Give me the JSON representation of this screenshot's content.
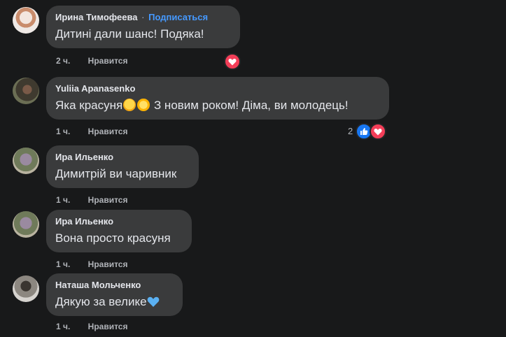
{
  "comments": [
    {
      "author": "Ирина Тимофеева",
      "separator": "·",
      "follow": "Подписаться",
      "text": "Дитині дали шанс! Подяка!",
      "time": "2 ч.",
      "like": "Нравится",
      "reactions": [
        "heart-icon"
      ]
    },
    {
      "author": "Yuliia Apanasenko",
      "text_before": "Яка красуня",
      "text_after": " З новим роком! Діма, ви молодець!",
      "emojis": [
        "star-struck-emoji",
        "sun-emoji"
      ],
      "time": "1 ч.",
      "like": "Нравится",
      "reaction_count": "2",
      "reactions": [
        "thumbs-up-icon",
        "heart-icon"
      ]
    },
    {
      "author": "Ира Ильенко",
      "text": "Димитрій ви чаривник",
      "time": "1 ч.",
      "like": "Нравится"
    },
    {
      "author": "Ира Ильенко",
      "text": "Вона просто красуня",
      "time": "1 ч.",
      "like": "Нравится"
    },
    {
      "author": "Наташа Мольченко",
      "text": "Дякую за велике",
      "emojis": [
        "blue-heart-emoji"
      ],
      "time": "1 ч.",
      "like": "Нравится"
    }
  ],
  "colors": {
    "background": "#18191a",
    "bubble": "#3a3b3c",
    "text": "#e4e6eb",
    "secondary": "#b0b3b8",
    "link": "#4599ff",
    "heart": "#f33e58",
    "like": "#1877f2"
  }
}
